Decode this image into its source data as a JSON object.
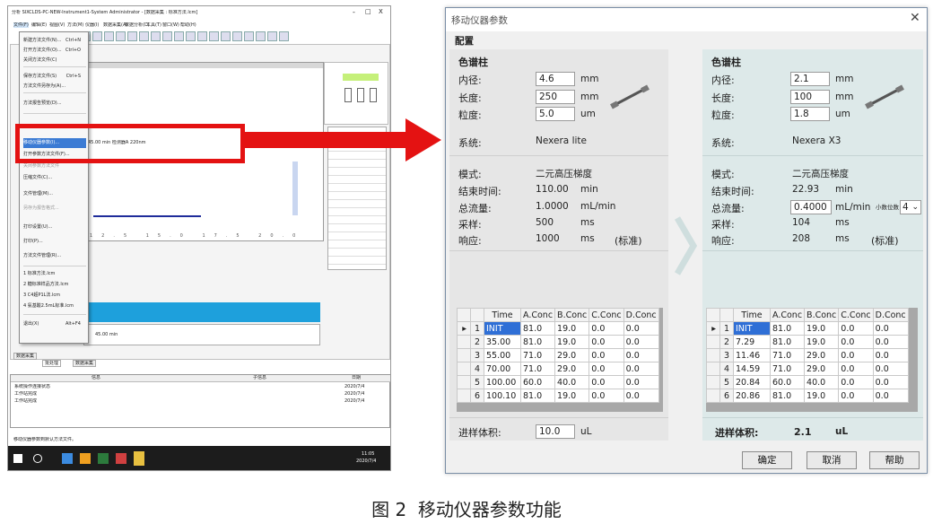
{
  "left_window": {
    "title": "分析 SIXCLDS-PC-NEW-Instrument1-System Administrator - [数据采集 : 标准方法.lcm]",
    "window_controls": [
      "-",
      "□",
      "X"
    ],
    "menu": [
      "文件(F)",
      "编辑(E)",
      "视图(V)",
      "方法(M)",
      "仪器(I)",
      "数据采集(A)",
      "数据分析(D)",
      "工具(T)",
      "窗口(W)",
      "帮助(H)"
    ],
    "file_menu_items": [
      {
        "label": "新建方法文件(N)...",
        "shortcut": "Ctrl+N"
      },
      {
        "label": "打开方法文件(O)...",
        "shortcut": "Ctrl+O"
      },
      {
        "label": "关闭方法文件(C)",
        "shortcut": ""
      },
      {
        "label": "保存方法文件(S)",
        "shortcut": "Ctrl+S"
      },
      {
        "label": "方法文件另存为(A)...",
        "shortcut": ""
      },
      {
        "label": "方法报告预览(D)...",
        "shortcut": ""
      },
      {
        "label": "移动仪器参数(I)...",
        "shortcut": ""
      },
      {
        "label": "打开参数方法文件(F)...",
        "shortcut": ""
      },
      {
        "label": "关闭参数方法文件",
        "shortcut": ""
      },
      {
        "label": "压缩文件(C)...",
        "shortcut": ""
      },
      {
        "label": "文件管理(M)...",
        "shortcut": ""
      },
      {
        "label": "另存为报告格式...",
        "shortcut": ""
      },
      {
        "label": "打印设置(U)...",
        "shortcut": ""
      },
      {
        "label": "打印(P)...",
        "shortcut": ""
      },
      {
        "label": "方法文件管理(R)...",
        "shortcut": ""
      },
      {
        "label": "1 标准方法.lcm",
        "shortcut": ""
      },
      {
        "label": "2 糖标准样品方法.lcm",
        "shortcut": ""
      },
      {
        "label": "3 C4超P1L法.lcm",
        "shortcut": ""
      },
      {
        "label": "4 氨基酸2.5mL标准.lcm",
        "shortcut": ""
      },
      {
        "label": "退出(X)",
        "shortcut": "Alt+F4"
      }
    ],
    "status_text": "移动仪器参数到默认方法文件。",
    "bottom_tabs": [
      "数据采集",
      "批处理",
      "数据采集"
    ],
    "log_headers": [
      "信息",
      "子信息",
      "日期"
    ],
    "log_rows": [
      {
        "msg": "系统操作连接状态",
        "sub": "",
        "date": "2020/7/4"
      },
      {
        "msg": "工作站完成",
        "sub": "",
        "date": "2020/7/4"
      },
      {
        "msg": "工作站完成",
        "sub": "",
        "date": "2020/7/4"
      }
    ],
    "dur_label": "45.00 min",
    "taskbar_time": "11:05",
    "taskbar_date": "2020/7/4"
  },
  "dialog": {
    "title": "移动仪器参数",
    "close_icon": "close-icon",
    "menu_label": "配置",
    "left": {
      "section_title": "色谱柱",
      "inner_diameter_label": "内径:",
      "inner_diameter": "4.6",
      "inner_diameter_unit": "mm",
      "length_label": "长度:",
      "length": "250",
      "length_unit": "mm",
      "particle_label": "粒度:",
      "particle": "5.0",
      "particle_unit": "um",
      "system_label": "系统:",
      "system": "Nexera lite",
      "mode_label": "模式:",
      "mode": "二元高压梯度",
      "end_time_label": "结束时间:",
      "end_time": "110.00",
      "end_time_unit": "min",
      "flow_label": "总流量:",
      "flow": "1.0000",
      "flow_unit": "mL/min",
      "sampling_label": "采样:",
      "sampling": "500",
      "sampling_unit": "ms",
      "response_label": "响应:",
      "response": "1000",
      "response_unit": "ms",
      "response_note": "(标准)",
      "table_headers": [
        "Time",
        "A.Conc",
        "B.Conc",
        "C.Conc",
        "D.Conc"
      ],
      "table_rows": [
        [
          "1",
          "INIT",
          "81.0",
          "19.0",
          "0.0",
          "0.0"
        ],
        [
          "2",
          "35.00",
          "81.0",
          "19.0",
          "0.0",
          "0.0"
        ],
        [
          "3",
          "55.00",
          "71.0",
          "29.0",
          "0.0",
          "0.0"
        ],
        [
          "4",
          "70.00",
          "71.0",
          "29.0",
          "0.0",
          "0.0"
        ],
        [
          "5",
          "100.00",
          "60.0",
          "40.0",
          "0.0",
          "0.0"
        ],
        [
          "6",
          "100.10",
          "81.0",
          "19.0",
          "0.0",
          "0.0"
        ]
      ],
      "inject_label": "进样体积:",
      "inject": "10.0",
      "inject_unit": "uL"
    },
    "right": {
      "section_title": "色谱柱",
      "inner_diameter_label": "内径:",
      "inner_diameter": "2.1",
      "inner_diameter_unit": "mm",
      "length_label": "长度:",
      "length": "100",
      "length_unit": "mm",
      "particle_label": "粒度:",
      "particle": "1.8",
      "particle_unit": "um",
      "system_label": "系统:",
      "system": "Nexera X3",
      "mode_label": "模式:",
      "mode": "二元高压梯度",
      "end_time_label": "结束时间:",
      "end_time": "22.93",
      "end_time_unit": "min",
      "flow_label": "总流量:",
      "flow": "0.4000",
      "flow_unit": "mL/min",
      "decimal_label": "小数位数",
      "decimal": "4",
      "sampling_label": "采样:",
      "sampling": "104",
      "sampling_unit": "ms",
      "response_label": "响应:",
      "response": "208",
      "response_unit": "ms",
      "response_note": "(标准)",
      "table_headers": [
        "Time",
        "A.Conc",
        "B.Conc",
        "C.Conc",
        "D.Conc"
      ],
      "table_rows": [
        [
          "1",
          "INIT",
          "81.0",
          "19.0",
          "0.0",
          "0.0"
        ],
        [
          "2",
          "7.29",
          "81.0",
          "19.0",
          "0.0",
          "0.0"
        ],
        [
          "3",
          "11.46",
          "71.0",
          "29.0",
          "0.0",
          "0.0"
        ],
        [
          "4",
          "14.59",
          "71.0",
          "29.0",
          "0.0",
          "0.0"
        ],
        [
          "5",
          "20.84",
          "60.0",
          "40.0",
          "0.0",
          "0.0"
        ],
        [
          "6",
          "20.86",
          "81.0",
          "19.0",
          "0.0",
          "0.0"
        ]
      ],
      "inject_label": "进样体积:",
      "inject": "2.1",
      "inject_unit": "uL"
    },
    "buttons": {
      "ok": "确定",
      "cancel": "取消",
      "help": "帮助"
    }
  },
  "caption": "图 2  移动仪器参数功能",
  "colors": {
    "highlight_red": "#e41212",
    "selection_blue": "#2f6fd6",
    "right_pane": "#dde9e9",
    "arrow": "#d0dede"
  }
}
